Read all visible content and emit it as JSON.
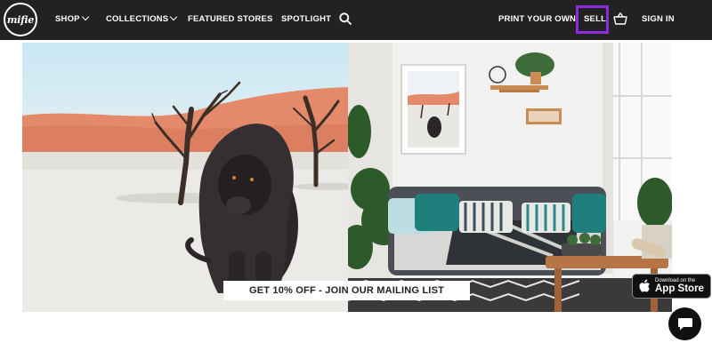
{
  "nav": {
    "logo_text": "mifie",
    "shop": "SHOP",
    "collections": "COLLECTIONS",
    "featured": "FEATURED STORES",
    "spotlight": "SPOTLIGHT",
    "print": "PRINT YOUR OWN",
    "sell": "SELL",
    "signin": "SIGN IN",
    "search_icon": "search-icon",
    "basket_icon": "basket-icon"
  },
  "hero": {
    "promo": "GET 10% OFF - JOIN OUR MAILING LIST"
  },
  "appstore": {
    "small": "Download on the",
    "big": "App Store"
  },
  "colors": {
    "nav_bg": "#222222",
    "highlight": "#8c2be0"
  }
}
